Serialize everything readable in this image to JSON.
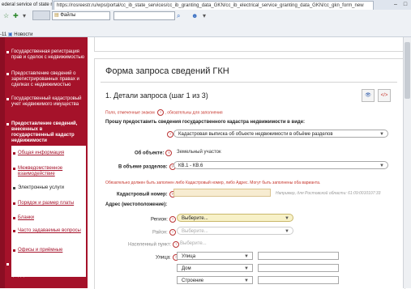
{
  "browser": {
    "tab_title": "ederal service of state registra... (RU)",
    "url": "https://rosreestr.ru/wps/portal/cc_ib_state_services/cc_ib_granting_data_GKN/cc_ib_electrical_service_granting_data_GKN/cc_gkn_form_new",
    "search_field": "Файлы",
    "zoom_prefix": "-11",
    "bookmark": "Новости"
  },
  "sidebar": {
    "items": [
      {
        "label": "Государственная регистрация прав и сделок с недвижимостью"
      },
      {
        "label": "Предоставление сведений о зарегистрированных правах и сделках с недвижимостью"
      },
      {
        "label": "Государственный кадастровый учет недвижимого имущества"
      },
      {
        "label": "Предоставление сведений, внесенных в государственный кадастр недвижимости"
      },
      {
        "label": "Лицензирование геодезических и картографических работ федерального назначения"
      }
    ],
    "subitems": [
      {
        "label": "Общая информация"
      },
      {
        "label": "Межведомственное взаимодействие"
      },
      {
        "label": "Электронные услуги"
      },
      {
        "label": "Порядок и размер платы"
      },
      {
        "label": "Бланки"
      },
      {
        "label": "Часто задаваемые вопросы"
      },
      {
        "label": "Офисы и приёмные"
      }
    ]
  },
  "form": {
    "title": "Форма запроса сведений ГКН",
    "step": "1. Детали запроса (шаг 1 из 3)",
    "required_note_left": "Поля, отмеченные знаком",
    "required_note_right": ", обязательны для заполнения",
    "request_heading": "Прошу предоставить сведения государственного кадастра недвижимости в виде:",
    "request_type": "Кадастровая выписка об объекте недвижимости в объёме разделов",
    "object_label": "Об объекте:",
    "object_value": "Земельный участок",
    "sections_label": "В объеме разделов:",
    "sections_value": "КВ.1 - КВ.6",
    "cadastral_warning": "Обязательно должен быть заполнен либо Кадастровый номер, либо Адрес. Могут быть заполнены оба варианта.",
    "cadastral_label": "Кадастровый номер:",
    "cadastral_hint": "Например, для Ростовской области: 61:09:0010107:33",
    "address_heading": "Адрес (местоположение):",
    "region_label": "Регион:",
    "region_value": "Выберите...",
    "district_label": "Район:",
    "district_value": "Выберите...",
    "locality_label": "Населенный пункт:",
    "locality_value": "Выберите...",
    "street_label": "Улица:",
    "street_type": "Улица",
    "house_type": "Дом",
    "building_type": "Строение"
  }
}
